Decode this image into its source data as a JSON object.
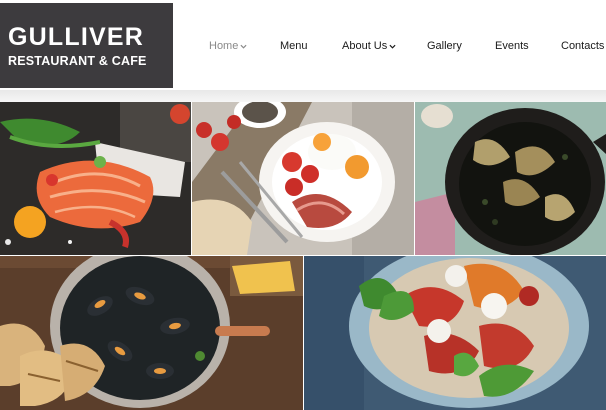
{
  "brand": {
    "title": "GULLIVER",
    "subtitle": "RESTAURANT & CAFE"
  },
  "nav": {
    "items": [
      {
        "label": "Home",
        "active": true,
        "dropdown": true
      },
      {
        "label": "Menu",
        "active": false,
        "dropdown": false
      },
      {
        "label": "About Us",
        "active": false,
        "dropdown": true
      },
      {
        "label": "Gallery",
        "active": false,
        "dropdown": false
      },
      {
        "label": "Events",
        "active": false,
        "dropdown": false
      },
      {
        "label": "Contacts",
        "active": false,
        "dropdown": false
      }
    ]
  },
  "colors": {
    "logo_bg": "#3d3b3e",
    "nav_active": "#8a8a8a",
    "nav_text": "#1a1a1a"
  },
  "gallery": {
    "tiles": [
      {
        "name": "salmon-dish-photo"
      },
      {
        "name": "breakfast-plate-photo"
      },
      {
        "name": "artichoke-skillet-photo"
      },
      {
        "name": "mussels-pan-photo"
      },
      {
        "name": "caprese-salad-photo"
      }
    ]
  }
}
